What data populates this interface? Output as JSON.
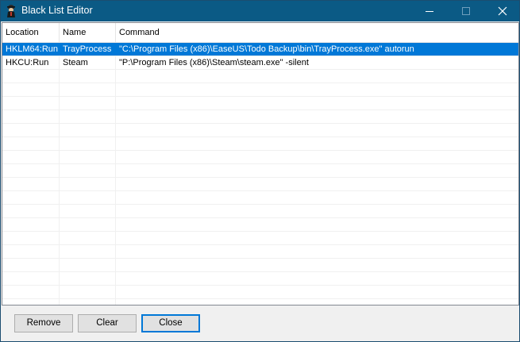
{
  "window": {
    "title": "Black List Editor",
    "icon": "app-icon",
    "controls": [
      "minimize-icon",
      "maximize-icon",
      "close-icon"
    ]
  },
  "list": {
    "columns": [
      "Location",
      "Name",
      "Command"
    ],
    "rows": [
      {
        "location": "HKLM64:Run",
        "name": "TrayProcess",
        "command": "\"C:\\Program Files (x86)\\EaseUS\\Todo Backup\\bin\\TrayProcess.exe\" autorun",
        "selected": true
      },
      {
        "location": "HKCU:Run",
        "name": "Steam",
        "command": "\"P:\\Program Files (x86)\\Steam\\steam.exe\" -silent",
        "selected": false
      }
    ]
  },
  "buttons": {
    "remove": "Remove",
    "clear": "Clear",
    "close": "Close"
  },
  "colors": {
    "titlebar": "#0b5a85",
    "selection": "#0078d7",
    "default_button_border": "#0078d7"
  }
}
